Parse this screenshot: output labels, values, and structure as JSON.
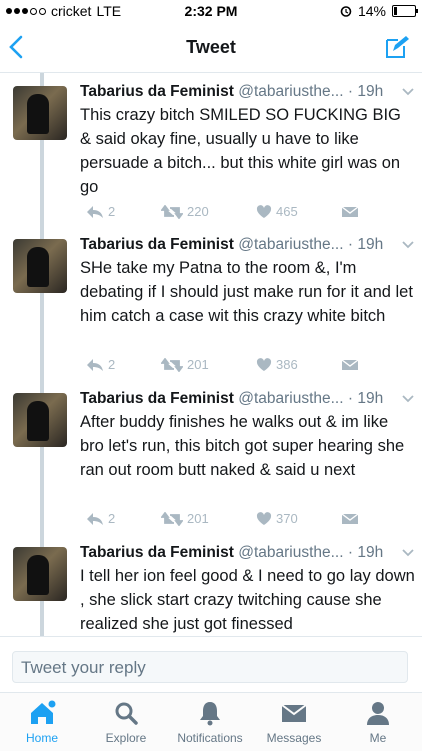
{
  "status_bar": {
    "carrier": "cricket",
    "network": "LTE",
    "time": "2:32 PM",
    "battery": "14%",
    "battery_level": 0.14
  },
  "nav": {
    "title": "Tweet"
  },
  "tweets": [
    {
      "name": "Tabarius da Feminist",
      "handle": "@tabariusthe...",
      "time": "· 19h",
      "text": "This crazy bitch SMILED SO FUCKING BIG & said okay fine, usually u have to like persuade a bitch... but this white girl was on go",
      "replies": "2",
      "retweets": "220",
      "likes": "465"
    },
    {
      "name": "Tabarius da Feminist",
      "handle": "@tabariusthe...",
      "time": "· 19h",
      "text": "SHe take my Patna to the room &, I'm debating if I should just make run for it and let him catch a case wit this crazy white bitch",
      "replies": "2",
      "retweets": "201",
      "likes": "386"
    },
    {
      "name": "Tabarius da Feminist",
      "handle": "@tabariusthe...",
      "time": "· 19h",
      "text": "After buddy finishes he walks out & im like bro let's run, this bitch got super hearing she ran out room butt naked & said u next",
      "replies": "2",
      "retweets": "201",
      "likes": "370"
    },
    {
      "name": "Tabarius da Feminist",
      "handle": "@tabariusthe...",
      "time": "· 19h",
      "text": "I tell her ion feel good & I need to go lay down , she slick start crazy twitching cause she realized she just got finessed",
      "replies": "",
      "retweets": "",
      "likes": ""
    }
  ],
  "reply": {
    "placeholder": "Tweet your reply"
  },
  "tabs": [
    {
      "label": "Home",
      "icon": "home-icon"
    },
    {
      "label": "Explore",
      "icon": "search-icon"
    },
    {
      "label": "Notifications",
      "icon": "bell-icon"
    },
    {
      "label": "Messages",
      "icon": "envelope-icon"
    },
    {
      "label": "Me",
      "icon": "person-icon"
    }
  ],
  "colors": {
    "accent": "#1da1f2",
    "muted": "#aab8c2"
  }
}
